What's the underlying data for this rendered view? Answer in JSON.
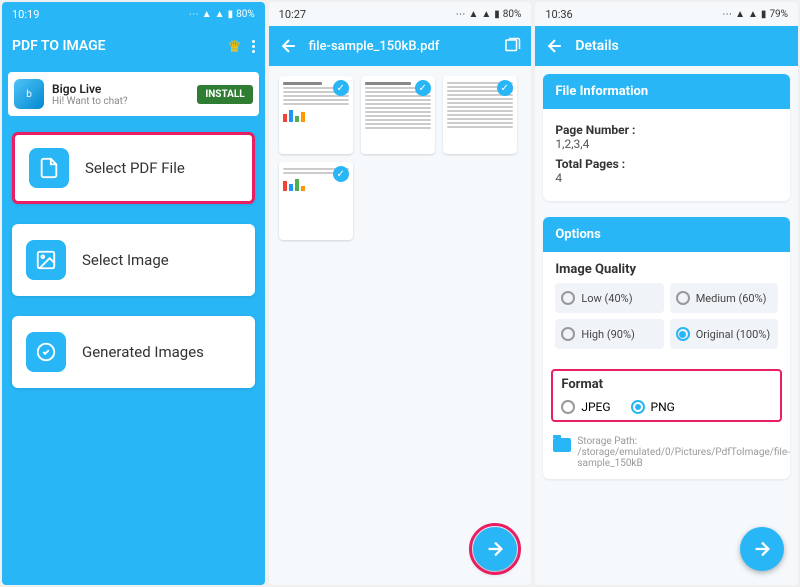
{
  "screen1": {
    "time": "10:19",
    "battery": "80%",
    "app_title": "PDF TO IMAGE",
    "ad": {
      "title": "Bigo Live",
      "subtitle": "Hi! Want to chat?",
      "install_label": "INSTALL"
    },
    "menu": {
      "select_pdf": "Select PDF File",
      "select_image": "Select Image",
      "generated": "Generated Images"
    }
  },
  "screen2": {
    "time": "10:27",
    "battery": "80%",
    "filename": "file-sample_150kB.pdf"
  },
  "screen3": {
    "time": "10:36",
    "battery": "79%",
    "title": "Details",
    "info_head": "File Information",
    "page_number_label": "Page Number :",
    "page_number_val": "1,2,3,4",
    "total_pages_label": "Total Pages :",
    "total_pages_val": "4",
    "options_head": "Options",
    "quality_label": "Image Quality",
    "quality_opts": {
      "low": "Low (40%)",
      "med": "Medium (60%)",
      "high": "High (90%)",
      "orig": "Original (100%)"
    },
    "format_label": "Format",
    "format_opts": {
      "jpeg": "JPEG",
      "png": "PNG"
    },
    "storage_label": "Storage Path: /storage/emulated/0/Pictures/PdfToImage/file-sample_150kB"
  }
}
